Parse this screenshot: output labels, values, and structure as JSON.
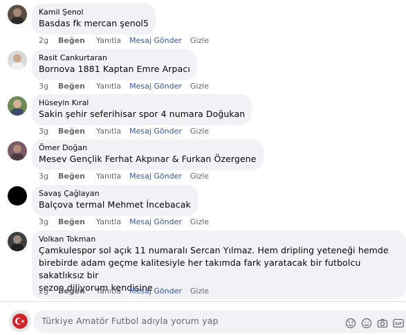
{
  "comments": [
    {
      "author": "Kamil Şenol",
      "text": "Basdas fk mercan şenol5",
      "time": "2g"
    },
    {
      "author": "Rasit Cankurtaran",
      "text": "Bornova 1881 Kaptan Emre Arpacı",
      "time": "3g"
    },
    {
      "author": "Hüseyin Kıral",
      "text": "Sakin şehir seferihisar spor 4 numara Doğukan",
      "time": "3g"
    },
    {
      "author": "Ömer Doğan",
      "text": "Mesev Gençlik Ferhat Akpınar & Furkan Özergene",
      "time": "3g"
    },
    {
      "author": "Savaş Çağlayan",
      "text": "Balçova termal Mehmet İncebacak",
      "time": "3g"
    },
    {
      "author": "Volkan Tokman",
      "text_lines": [
        "Çamkulespor sol açık 11 numaralı Sercan Yılmaz. Hem dripling yeteneği hemde",
        "birebirde adam geçme kalitesiyle her takımda fark yaratacak bir futbolcu sakatlıksız bir",
        "sezon diliyorum kendisine"
      ],
      "time": "2g"
    }
  ],
  "actions": {
    "like": "Beğen",
    "reply": "Yanıtla",
    "message": "Mesaj Gönder",
    "hide": "Gizle"
  },
  "composer": {
    "placeholder": "Türkiye Amatör Futbol adıyla yorum yap"
  },
  "icons": [
    "sticker-icon",
    "emoji-icon",
    "camera-icon",
    "gif-icon"
  ],
  "colors": {
    "bubble": "#f0f2f5",
    "link": "#385898",
    "meta": "#65676b"
  }
}
